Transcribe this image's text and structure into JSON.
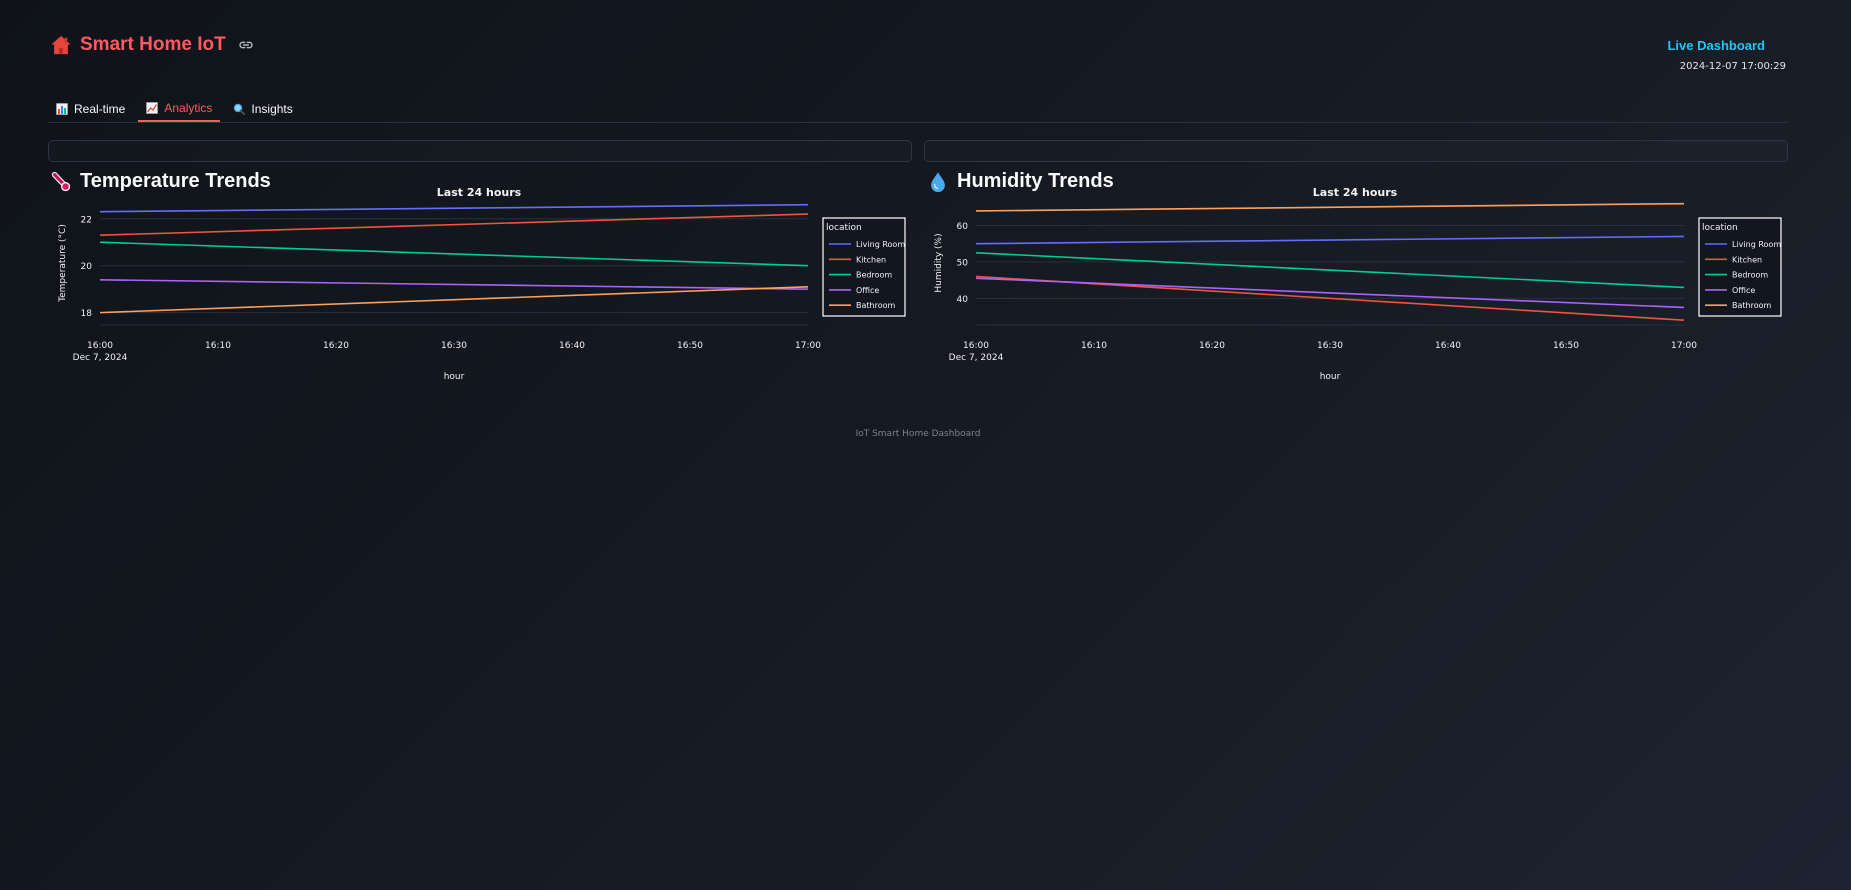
{
  "app": {
    "title": "Smart Home IoT",
    "status": "Live Dashboard",
    "timestamp": "2024-12-07 17:00:29",
    "footer": "IoT Smart Home Dashboard"
  },
  "tabs": [
    {
      "label": "Real-time",
      "icon": "bar-chart-icon",
      "active": false
    },
    {
      "label": "Analytics",
      "icon": "trend-chart-icon",
      "active": true
    },
    {
      "label": "Insights",
      "icon": "magnifier-icon",
      "active": false
    }
  ],
  "colors": {
    "accent": "#ff5a5f",
    "live": "#1fc8f0",
    "Living Room": "#636efa",
    "Kitchen": "#ef553b",
    "Bedroom": "#00cc96",
    "Office": "#ab63fa",
    "Bathroom": "#ffa15a"
  },
  "panels": {
    "temperature": {
      "title": "Temperature Trends",
      "icon": "thermometer-icon"
    },
    "humidity": {
      "title": "Humidity Trends",
      "icon": "droplet-icon"
    }
  },
  "chart_data": [
    {
      "type": "line",
      "title": "Last 24 hours",
      "xlabel": "hour",
      "ylabel": "Temperature (°C)",
      "x": [
        "16:00",
        "17:00"
      ],
      "x_ticks": [
        "16:00",
        "16:10",
        "16:20",
        "16:30",
        "16:40",
        "16:50",
        "17:00"
      ],
      "x_date_label": "Dec 7, 2024",
      "y_ticks": [
        18,
        20,
        22
      ],
      "ylim": [
        17.6,
        22.8
      ],
      "legend_title": "location",
      "legend_position": "right",
      "series": [
        {
          "name": "Living Room",
          "values": [
            22.3,
            22.6
          ]
        },
        {
          "name": "Kitchen",
          "values": [
            21.3,
            22.2
          ]
        },
        {
          "name": "Bedroom",
          "values": [
            21.0,
            20.0
          ]
        },
        {
          "name": "Office",
          "values": [
            19.4,
            19.0
          ]
        },
        {
          "name": "Bathroom",
          "values": [
            18.0,
            19.1
          ]
        }
      ]
    },
    {
      "type": "line",
      "title": "Last 24 hours",
      "xlabel": "hour",
      "ylabel": "Humidity (%)",
      "x": [
        "16:00",
        "17:00"
      ],
      "x_ticks": [
        "16:00",
        "16:10",
        "16:20",
        "16:30",
        "16:40",
        "16:50",
        "17:00"
      ],
      "x_date_label": "Dec 7, 2024",
      "y_ticks": [
        40,
        50,
        60
      ],
      "ylim": [
        33.5,
        67
      ],
      "legend_title": "location",
      "legend_position": "right",
      "series": [
        {
          "name": "Living Room",
          "values": [
            55,
            57
          ]
        },
        {
          "name": "Kitchen",
          "values": [
            46,
            34
          ]
        },
        {
          "name": "Bedroom",
          "values": [
            52.5,
            43
          ]
        },
        {
          "name": "Office",
          "values": [
            45.5,
            37.5
          ]
        },
        {
          "name": "Bathroom",
          "values": [
            64,
            66
          ]
        }
      ]
    }
  ]
}
